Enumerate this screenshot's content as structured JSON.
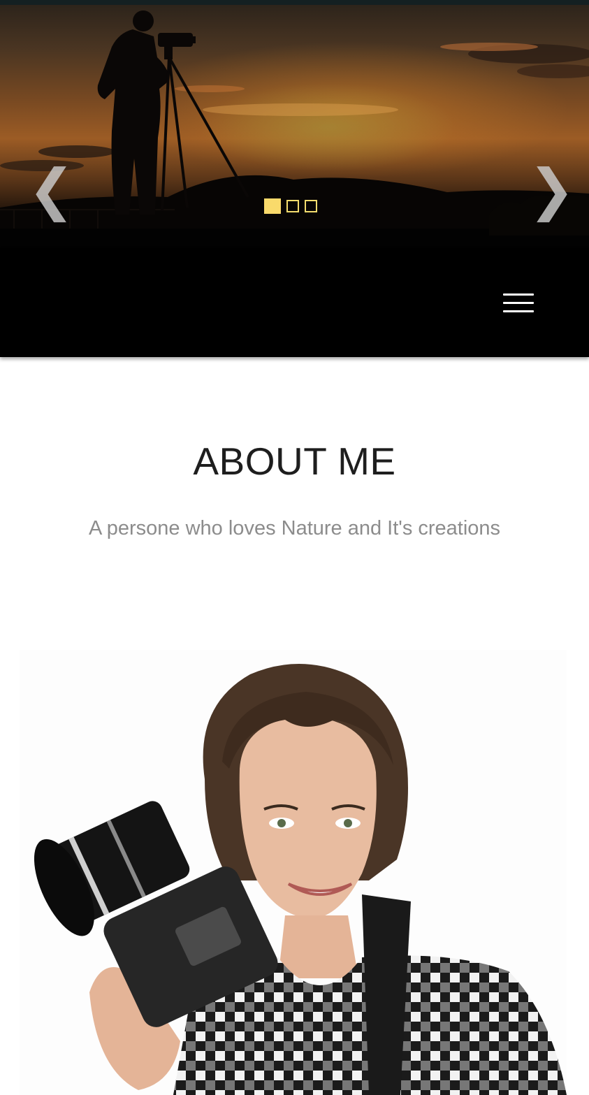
{
  "hero": {
    "prev_arrow": "❮",
    "next_arrow": "❯",
    "slides": [
      {
        "label": "slide-1",
        "active": true
      },
      {
        "label": "slide-2",
        "active": false
      },
      {
        "label": "slide-3",
        "active": false
      }
    ],
    "indicator_active_color": "#f9da6b"
  },
  "header": {
    "menu_icon": "hamburger-menu-icon",
    "background": "#000000"
  },
  "about": {
    "title": "ABOUT ME",
    "subtitle": "A persone who loves Nature and It's creations"
  },
  "icons": {
    "prev": "chevron-left-icon",
    "next": "chevron-right-icon",
    "menu": "hamburger-menu-icon"
  }
}
